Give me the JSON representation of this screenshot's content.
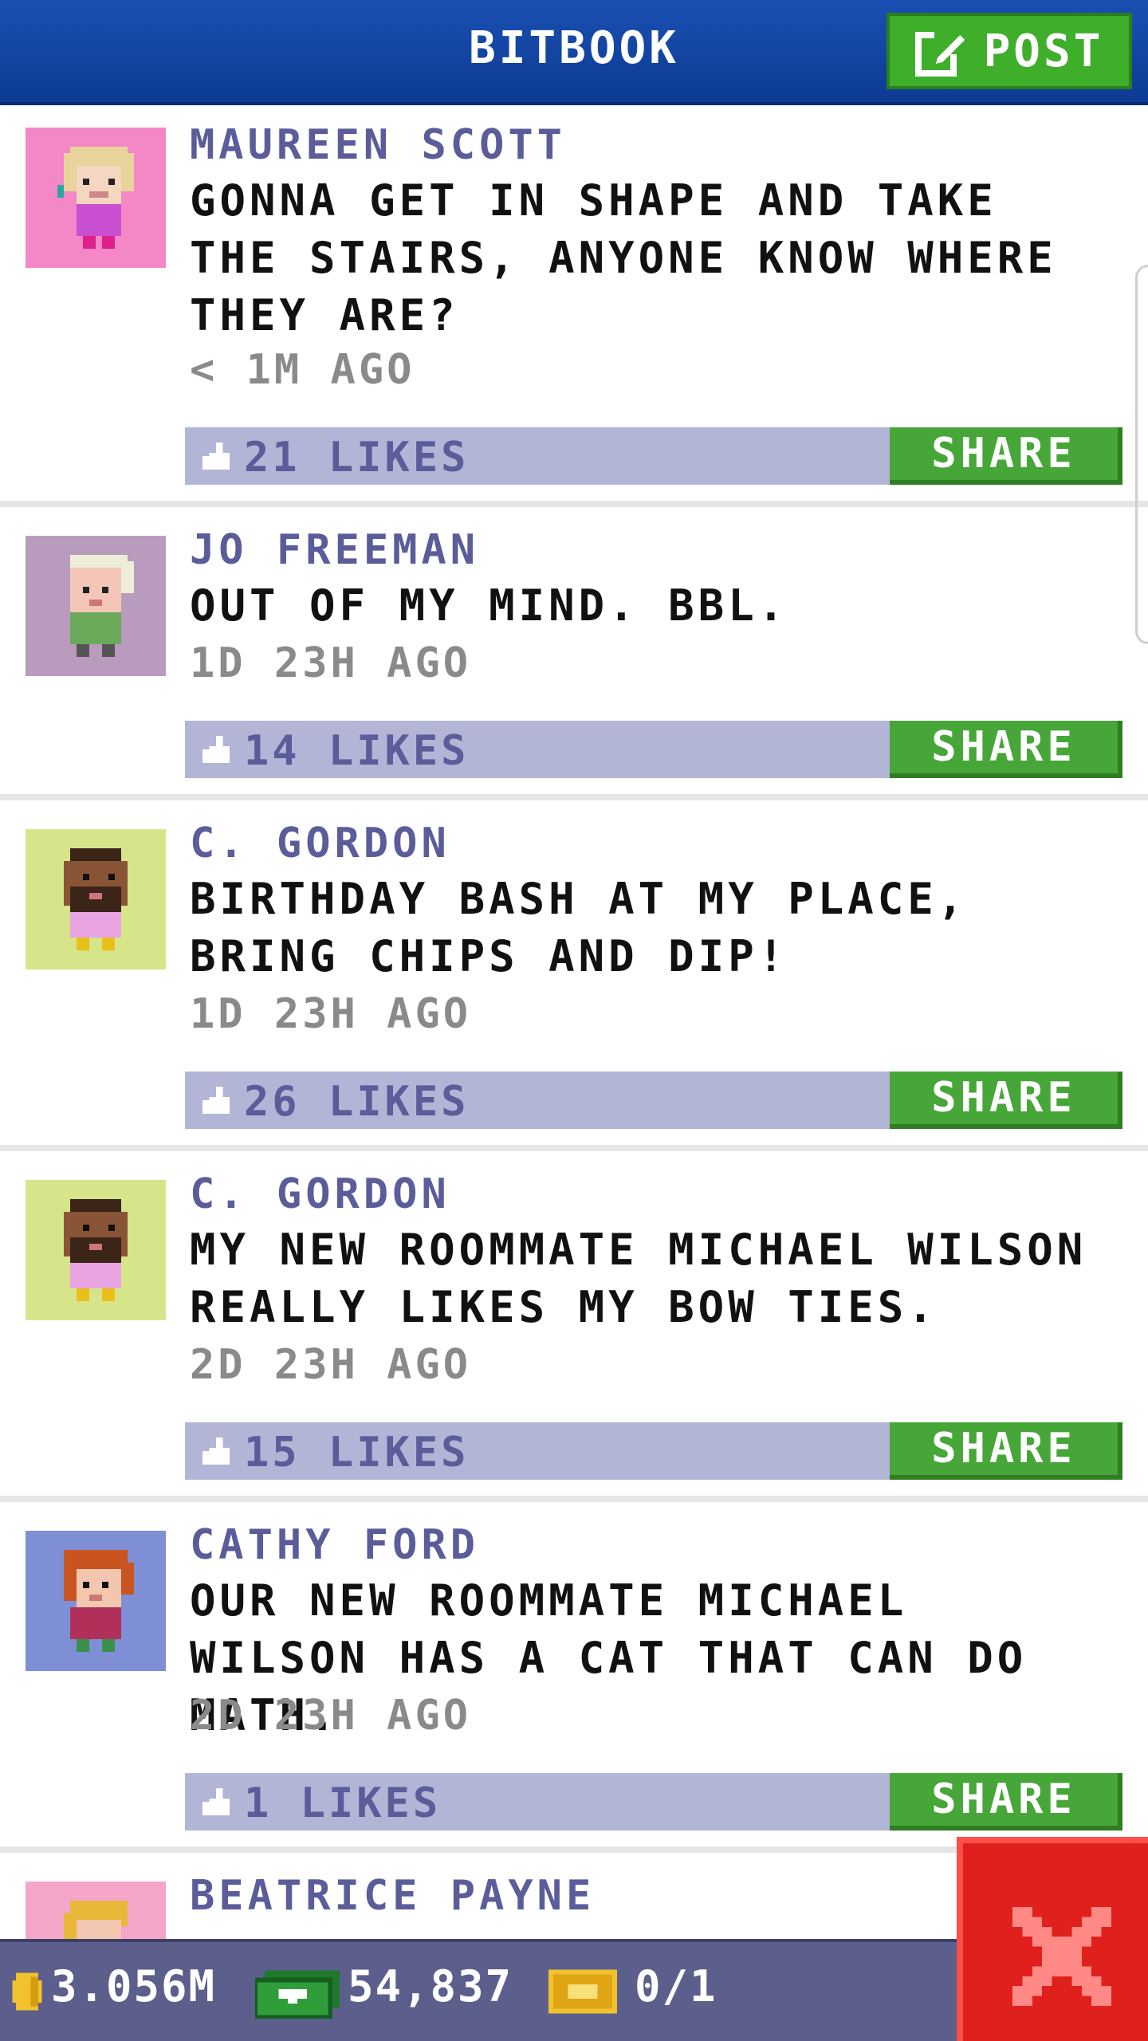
{
  "header": {
    "title": "BITBOOK",
    "post_label": "POST",
    "post_icon": "edit-icon"
  },
  "colors": {
    "header_blue": "#1a4fb2",
    "action_green": "#46a638",
    "like_bar": "#b3b5d6",
    "author_text": "#5b5c9a",
    "close_red": "#e0201c"
  },
  "posts": [
    {
      "author": "MAUREEN SCOTT",
      "message": "GONNA GET IN SHAPE AND TAKE THE STAIRS, ANYONE KNOW WHERE THEY ARE?",
      "time": "< 1M AGO",
      "likes": "21 LIKES",
      "share_label": "SHARE",
      "avatar_bg": "#f487c6"
    },
    {
      "author": "JO FREEMAN",
      "message": "OUT OF MY MIND. BBL.",
      "time": "1D 23H AGO",
      "likes": "14 LIKES",
      "share_label": "SHARE",
      "avatar_bg": "#b99bbd"
    },
    {
      "author": "C. GORDON",
      "message": "BIRTHDAY BASH AT MY PLACE, BRING CHIPS AND DIP!",
      "time": "1D 23H AGO",
      "likes": "26 LIKES",
      "share_label": "SHARE",
      "avatar_bg": "#d6e58a"
    },
    {
      "author": "C. GORDON",
      "message": "MY NEW ROOMMATE MICHAEL WILSON REALLY LIKES MY BOW TIES.",
      "time": "2D 23H AGO",
      "likes": "15 LIKES",
      "share_label": "SHARE",
      "avatar_bg": "#d6e58a"
    },
    {
      "author": "CATHY FORD",
      "message": "OUR NEW ROOMMATE MICHAEL WILSON HAS A CAT THAT CAN DO MATH.",
      "time": "2D 23H AGO",
      "likes": "1 LIKES",
      "share_label": "SHARE",
      "avatar_bg": "#7f8fd6"
    },
    {
      "author": "BEATRICE PAYNE",
      "avatar_bg": "#f4a5c8"
    }
  ],
  "status": {
    "coins": "3.056M",
    "cash": "54,837",
    "bux": "0/1"
  }
}
